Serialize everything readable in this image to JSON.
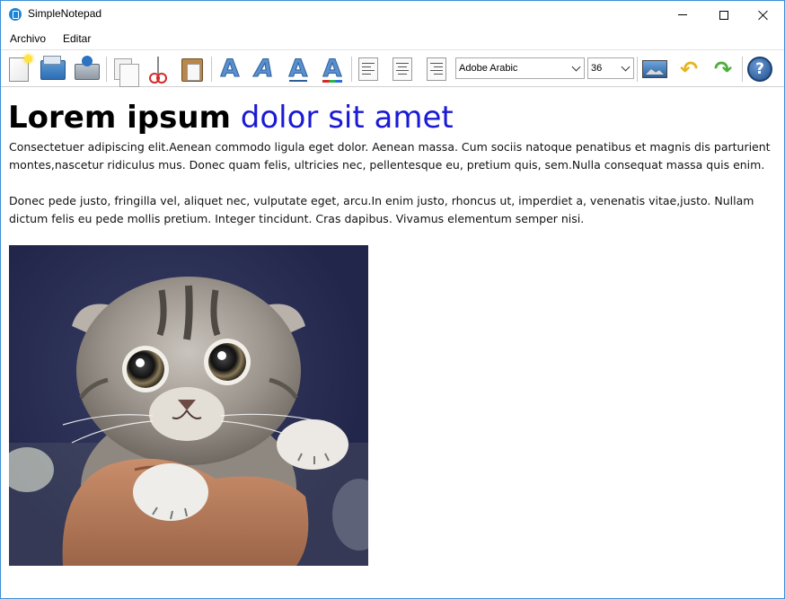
{
  "window": {
    "title": "SimpleNotepad"
  },
  "menu": {
    "items": [
      "Archivo",
      "Editar"
    ]
  },
  "toolbar": {
    "buttons": [
      "new-document-icon",
      "open-folder-icon",
      "save-icon",
      "copy-icon",
      "cut-icon",
      "paste-icon",
      "bold-icon",
      "italic-icon",
      "underline-icon",
      "font-color-icon",
      "align-left-icon",
      "align-center-icon",
      "align-right-icon",
      "insert-image-icon",
      "undo-icon",
      "redo-icon",
      "help-icon"
    ],
    "font_family": "Adobe Arabic",
    "font_size": "36"
  },
  "document": {
    "heading_bold": "Lorem ipsum",
    "heading_colored": "dolor sit amet",
    "heading_colored_color": "#1a1ad6",
    "paragraph1": "Consectetuer adipiscing elit.Aenean commodo ligula eget dolor. Aenean massa. Cum sociis natoque penatibus et magnis dis parturient montes,nascetur ridiculus mus. Donec quam felis, ultricies nec, pellentesque eu, pretium quis, sem.Nulla consequat massa quis enim.",
    "paragraph2": "Donec pede justo, fringilla vel, aliquet nec, vulputate eget, arcu.In enim justo, rhoncus ut, imperdiet a, venenatis vitae,justo. Nullam dictum felis eu pede mollis pretium. Integer tincidunt. Cras dapibus. Vivamus elementum semper nisi.",
    "image": "kitten-photo"
  }
}
